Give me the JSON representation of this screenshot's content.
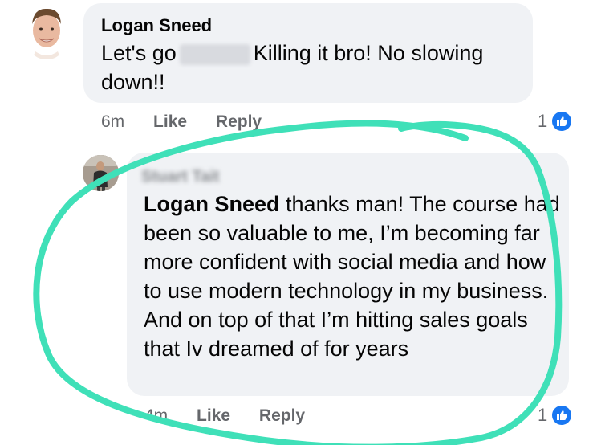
{
  "comments": [
    {
      "author": "Logan Sneed",
      "text_before": "Let's go",
      "redacted_name": "Stuart",
      "text_after": "Killing it bro! No slowing down!!",
      "time": "6m",
      "like_label": "Like",
      "reply_label": "Reply",
      "reaction_count": "1",
      "reaction_icon": "thumbs-up-icon"
    },
    {
      "author": "Stuart Tait",
      "mention": "Logan Sneed",
      "text": "thanks man! The course had been so valuable to me, I’m becoming far more confident with social media and how to use modern technology in my business.  And on top of that I’m hitting sales goals that Iv dreamed of for years",
      "time": "4m",
      "like_label": "Like",
      "reply_label": "Reply",
      "reaction_count": "1",
      "reaction_icon": "thumbs-up-icon"
    }
  ],
  "colors": {
    "bubble": "#f0f2f5",
    "meta_text": "#65676b",
    "like_blue": "#1877f2",
    "annotation_stroke": "#3fe0b8"
  }
}
